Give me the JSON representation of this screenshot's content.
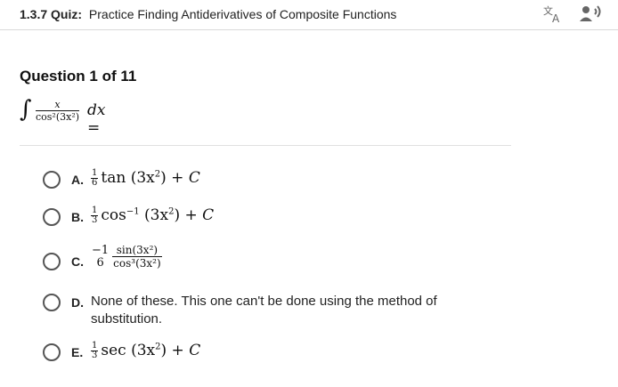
{
  "header": {
    "quiz_number": "1.3.7",
    "quiz_label": "Quiz:",
    "quiz_title": "Practice Finding Antiderivatives of Composite Functions",
    "translate_icon": "translate-icon",
    "audio_icon": "speaker-icon"
  },
  "question": {
    "label": "Question 1 of 11",
    "integrand_num": "x",
    "integrand_den": "cos²(3x²)",
    "tail": "dx ="
  },
  "options": [
    {
      "letter": "A.",
      "coef_num": "1",
      "coef_den": "6",
      "func": "tan",
      "arg": "(3x",
      "exp": "2",
      "close": ") + ",
      "const": "C"
    },
    {
      "letter": "B.",
      "coef_num": "1",
      "coef_den": "3",
      "func": "cos",
      "func_sup": "−1",
      "arg": " (3x",
      "exp": "2",
      "close": ") + ",
      "const": "C"
    },
    {
      "letter": "C.",
      "coef_num": "−1",
      "coef_den": "6",
      "num2": "sin(3x²)",
      "den2": "cos³(3x²)"
    },
    {
      "letter": "D.",
      "text": "None of these. This one can't be done using the method of substitution."
    },
    {
      "letter": "E.",
      "coef_num": "1",
      "coef_den": "3",
      "func": "sec",
      "arg": " (3x",
      "exp": "2",
      "close": ") + ",
      "const": "C"
    }
  ]
}
